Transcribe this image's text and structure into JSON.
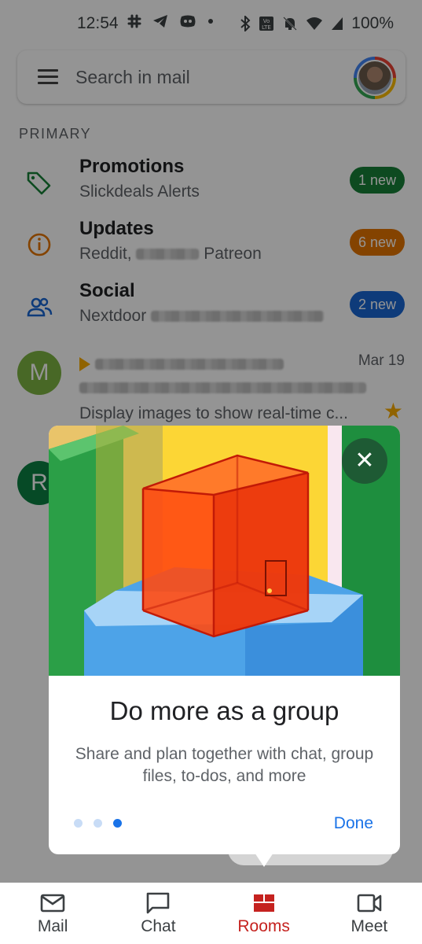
{
  "status_bar": {
    "time": "12:54",
    "battery": "100%"
  },
  "search": {
    "placeholder": "Search in mail"
  },
  "section_label": "PRIMARY",
  "categories": [
    {
      "title": "Promotions",
      "subtitle": "Slickdeals Alerts",
      "badge": "1 new",
      "color": "#188038",
      "icon": "tag-icon"
    },
    {
      "title": "Updates",
      "subtitle_prefix": "Reddit, ",
      "subtitle_suffix": " Patreon",
      "badge": "6 new",
      "color": "#e37400",
      "icon": "info-icon"
    },
    {
      "title": "Social",
      "subtitle_prefix": "Nextdoor",
      "badge": "2 new",
      "color": "#1967d2",
      "icon": "people-icon"
    }
  ],
  "emails": [
    {
      "avatar_letter": "M",
      "avatar_color": "#7cb342",
      "date": "Mar 19",
      "snippet": "Display images to show real-time c...",
      "starred": true
    },
    {
      "avatar_letter": "R",
      "avatar_color": "#0b8043"
    }
  ],
  "promo": {
    "title": "Do more as a group",
    "description": "Share and plan together with chat, group files, to-dos, and more",
    "done_label": "Done",
    "close_icon": "close-icon",
    "pages": 3,
    "current_page": 3
  },
  "bottom_nav": [
    {
      "label": "Mail",
      "icon": "mail-icon",
      "active": false
    },
    {
      "label": "Chat",
      "icon": "chat-icon",
      "active": false
    },
    {
      "label": "Rooms",
      "icon": "rooms-icon",
      "active": true
    },
    {
      "label": "Meet",
      "icon": "meet-icon",
      "active": false
    }
  ],
  "colors": {
    "accent": "#1a73e8",
    "active_nav": "#c5221f",
    "close_button": "#1e5a34"
  }
}
